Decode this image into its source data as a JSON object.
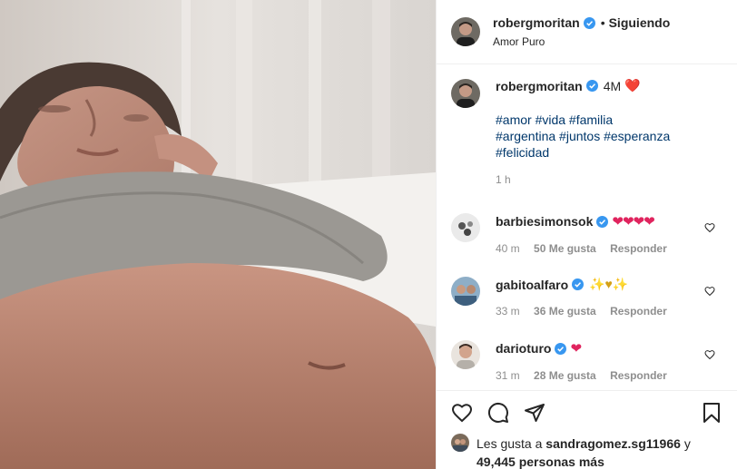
{
  "post": {
    "author": "robergmoritan",
    "follow_status": "Siguiendo",
    "dot": "•",
    "location": "Amor Puro",
    "more": "•••"
  },
  "caption": {
    "author": "robergmoritan",
    "time_inline": "4M",
    "heart_emoji": "❤️",
    "hashtag_lines": [
      "#amor #vida #familia",
      "#argentina #juntos #esperanza",
      "#felicidad"
    ],
    "time": "1 h"
  },
  "comments": [
    {
      "user": "barbiesimonsok",
      "text": "❤❤❤❤",
      "time": "40 m",
      "likes": "50 Me gusta",
      "reply": "Responder"
    },
    {
      "user": "gabitoalfaro",
      "text": "✨♥✨",
      "time": "33 m",
      "likes": "36 Me gusta",
      "reply": "Responder"
    },
    {
      "user": "darioturo",
      "text": "❤",
      "time": "31 m",
      "likes": "28 Me gusta",
      "reply": "Responder"
    }
  ],
  "likes": {
    "prefix": "Les gusta a",
    "user": "sandragomez.sg11966",
    "conj": "y",
    "rest": "49,445 personas más"
  },
  "colors": {
    "link": "#00376b",
    "verified": "#3897f0",
    "muted": "#8e8e8e",
    "heart": "#ed4956"
  },
  "icons": [
    "heart-icon",
    "comment-icon",
    "share-icon",
    "bookmark-icon",
    "verified-badge-icon"
  ]
}
